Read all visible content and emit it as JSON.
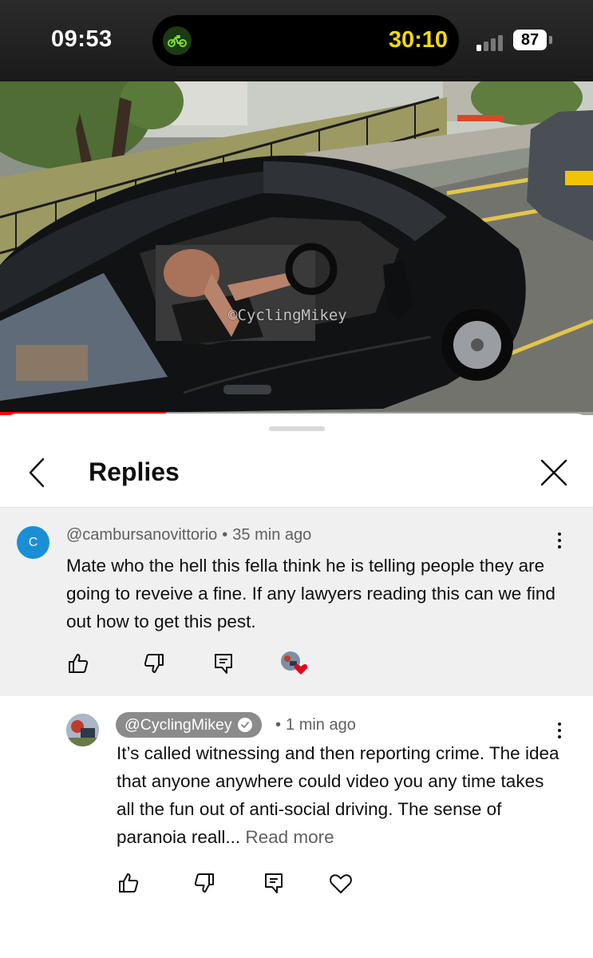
{
  "status_bar": {
    "time": "09:53",
    "activity_icon": "cycling-icon",
    "activity_timer": "30:10",
    "battery_percent": "87",
    "signal_bars_active": 1,
    "signal_bars_total": 4
  },
  "video": {
    "watermark": "©CyclingMikey",
    "progress_fraction": 0.28
  },
  "sheet": {
    "title": "Replies",
    "back_icon": "chevron-left-icon",
    "close_icon": "close-icon"
  },
  "parent_comment": {
    "avatar_letter": "C",
    "avatar_color": "#1a8fd6",
    "author": "@cambursanovittorio",
    "separator": "•",
    "time": "35 min ago",
    "text": "Mate who the hell this fella think he is telling people they are going to reveive a fine. If any lawyers reading this can we find out how to get this pest.",
    "actions": [
      "like-icon",
      "dislike-icon",
      "reply-icon",
      "creator-heart-badge"
    ]
  },
  "reply": {
    "author": "@CyclingMikey",
    "verified": true,
    "separator": "•",
    "time": "1 min ago",
    "text": "It’s called witnessing and then reporting crime. The idea that anyone anywhere could video you any time takes all the fun out of anti-social driving. The sense of paranoia reall...",
    "read_more": "Read more",
    "actions": [
      "like-icon",
      "dislike-icon",
      "reply-icon",
      "heart-icon"
    ]
  },
  "colors": {
    "progress": "#ff0000",
    "heart_badge": "#e8001c",
    "author_pill": "#8b8b8b",
    "parent_bg": "#f0f0f0",
    "timer": "#f5d90a"
  }
}
